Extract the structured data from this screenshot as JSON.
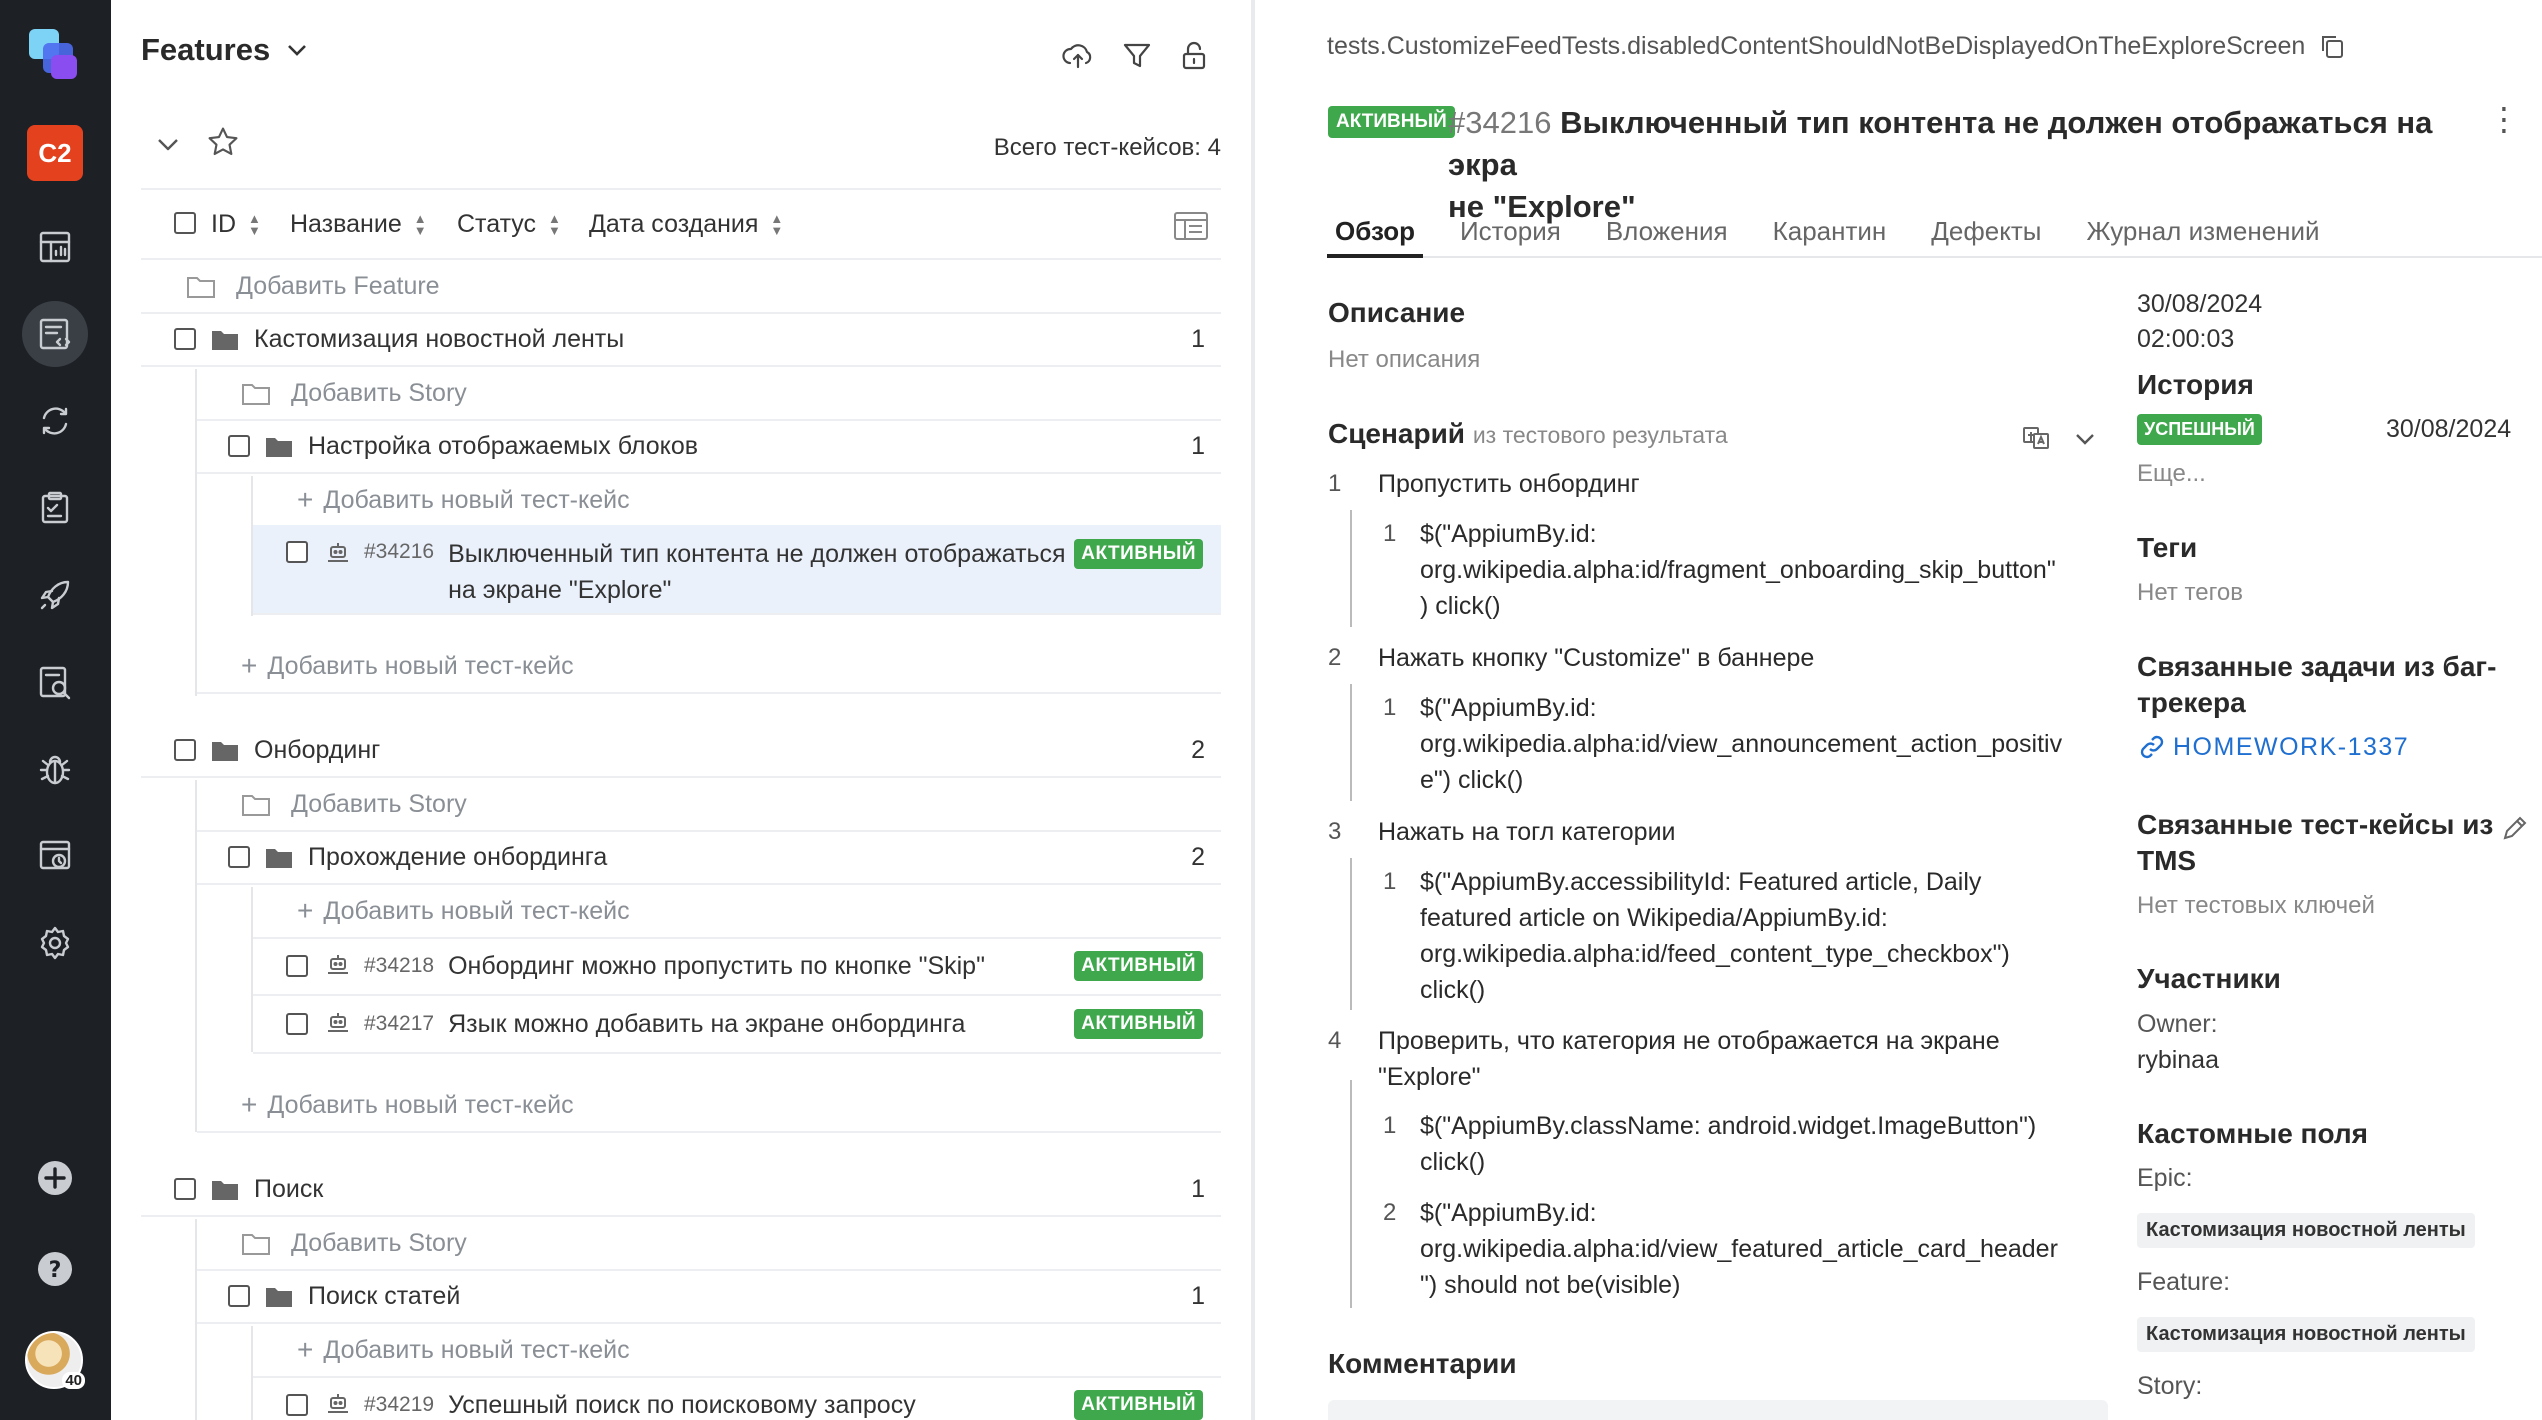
{
  "sidebar": {
    "project_badge": "C2",
    "nav_icons": [
      "dashboard-icon",
      "test-cases-icon",
      "launches-icon",
      "test-plans-icon",
      "jobs-icon",
      "analytics-icon",
      "defects-icon",
      "reports-icon",
      "settings-icon"
    ],
    "bottom_icons": [
      "add-icon",
      "help-icon"
    ],
    "avatar_badge": "40"
  },
  "tree": {
    "title": "Features",
    "total_label": "Всего тест-кейсов: 4",
    "columns": [
      "ID",
      "Название",
      "Статус",
      "Дата создания"
    ],
    "add_feature": "Добавить Feature",
    "add_story": "Добавить Story",
    "add_case": "Добавить новый тест-кейс",
    "status_active": "АКТИВНЫЙ",
    "groups": [
      {
        "name": "Кастомизация новостной ленты",
        "count": "1",
        "story": "Настройка отображаемых блоков",
        "story_count": "1",
        "cases": [
          {
            "id": "#34216",
            "line1": "Выключенный тип контента не должен отображаться",
            "line2": "на экране \"Explore\""
          }
        ]
      },
      {
        "name": "Онбординг",
        "count": "2",
        "story": "Прохождение онбординга",
        "story_count": "2",
        "cases": [
          {
            "id": "#34218",
            "line1": "Онбординг можно пропустить по кнопке \"Skip\""
          },
          {
            "id": "#34217",
            "line1": "Язык можно добавить на экране онбординга"
          }
        ]
      },
      {
        "name": "Поиск",
        "count": "1",
        "story": "Поиск статей",
        "story_count": "1",
        "cases": [
          {
            "id": "#34219",
            "line1": "Успешный поиск по поисковому запросу"
          }
        ]
      }
    ]
  },
  "detail": {
    "path": "tests.CustomizeFeedTests.disabledContentShouldNotBeDisplayedOnTheExploreScreen",
    "status": "АКТИВНЫЙ",
    "number": "#34216",
    "title_line1": "Выключенный тип контента не должен отображаться на экра",
    "title_line2": "не \"Explore\"",
    "tabs": [
      "Обзор",
      "История",
      "Вложения",
      "Карантин",
      "Дефекты",
      "Журнал изменений"
    ],
    "description_h": "Описание",
    "description": "Нет описания",
    "scenario_h": "Сценарий",
    "scenario_sub": "из тестового результата",
    "steps": [
      {
        "n": "1",
        "text": "Пропустить онбординг",
        "sub": [
          {
            "n": "1",
            "lines": [
              "$(\"AppiumBy.id:",
              "org.wikipedia.alpha:id/fragment_onboarding_skip_button\"",
              ") click()"
            ]
          }
        ]
      },
      {
        "n": "2",
        "text": "Нажать кнопку \"Customize\" в баннере",
        "sub": [
          {
            "n": "1",
            "lines": [
              "$(\"AppiumBy.id:",
              "org.wikipedia.alpha:id/view_announcement_action_positiv",
              "e\") click()"
            ]
          }
        ]
      },
      {
        "n": "3",
        "text": "Нажать на тогл категории",
        "sub": [
          {
            "n": "1",
            "lines": [
              "$(\"AppiumBy.accessibilityId: Featured article, Daily",
              "featured article on Wikipedia/AppiumBy.id:",
              "org.wikipedia.alpha:id/feed_content_type_checkbox\")",
              "click()"
            ]
          }
        ]
      },
      {
        "n": "4",
        "text": "Проверить, что категория не отображается на экране",
        "text2": "\"Explore\"",
        "sub": [
          {
            "n": "1",
            "lines": [
              "$(\"AppiumBy.className: android.widget.ImageButton\")",
              "click()"
            ]
          },
          {
            "n": "2",
            "lines": [
              "$(\"AppiumBy.id:",
              "org.wikipedia.alpha:id/view_featured_article_card_header",
              "\") should not be(visible)"
            ]
          }
        ]
      }
    ],
    "comments_h": "Комментарии",
    "meta": {
      "date": "30/08/2024",
      "time": "02:00:03",
      "history_h": "История",
      "history_badge": "УСПЕШНЫЙ",
      "history_date": "30/08/2024",
      "more": "Еще...",
      "tags_h": "Теги",
      "tags": "Нет тегов",
      "issues_h1": "Связанные задачи из баг-",
      "issues_h2": "трекера",
      "issue_link": "HOMEWORK-1337",
      "linked_h1": "Связанные тест-кейсы из",
      "linked_h2": "TMS",
      "linked": "Нет тестовых ключей",
      "members_h": "Участники",
      "owner_label": "Owner:",
      "owner": "rybinaa",
      "custom_h": "Кастомные поля",
      "epic_label": "Epic:",
      "epic_value": "Кастомизация новостной ленты",
      "feature_label": "Feature:",
      "feature_value": "Кастомизация новостной ленты",
      "story_label": "Story:"
    }
  },
  "colors": {
    "rail": "#1d2126",
    "active_badge": "#3fa84d",
    "project_badge": "#e4411f",
    "link": "#1f6fd1",
    "selected_row": "#eaf1fb"
  }
}
